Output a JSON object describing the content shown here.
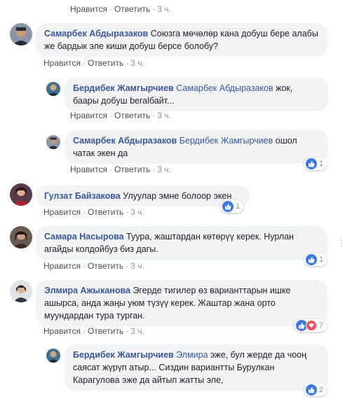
{
  "actions": {
    "like": "Нравится",
    "reply": "Ответить",
    "sep": "·"
  },
  "colors": {
    "author": "#385898",
    "bubble": "#f2f3f5",
    "like": "#3b78e7",
    "love": "#f0505b"
  },
  "comments": [
    {
      "time": "3 ч."
    },
    {
      "author": "Самарбек Абдыразаков",
      "text": "Союзга мөчөлөр кана добуш бере алабы же бардык эле киши добуш берсе болобу?",
      "time": "3 ч."
    },
    {
      "author": "Бердибек Жамгырчиев",
      "mention": "Самарбек Абдыразаков",
      "text": "жок, баары добуш beralбайт...",
      "time": "3 ч."
    },
    {
      "author": "Самарбек Абдыразаков",
      "mention": "Бердибек Жамгырчиев",
      "text": "ошол чатак экен да",
      "time": "3 ч.",
      "reaction_count": "1"
    },
    {
      "author": "Гулзат Байзакова",
      "text": "Улуулар эмне болоор экен",
      "time": "3 ч.",
      "reaction_count": "1"
    },
    {
      "author": "Самара Насырова",
      "text": "Туура, жаштардан көтөрүү керек. Нурлан агайды колдойбуз биз дагы.",
      "time": "3 ч.",
      "reaction_count": "1"
    },
    {
      "author": "Элмира Ажыканова",
      "text": "Эгерде тигилер өз варианттарын ишке ашырса, анда жаңы уюм түзүү керек. Жаштар жана орто муундардан тура турган.",
      "time": "3 ч.",
      "reaction_count": "7"
    },
    {
      "author": "Бердибек Жамгырчиев",
      "mention": "Элмира",
      "text": "эже, бул жерде да чооң саясат жүрүп атыр... Сиздин вариантты Бурулкан Карагулова эже да айтып жатты эле,",
      "reaction_count": "2"
    }
  ]
}
